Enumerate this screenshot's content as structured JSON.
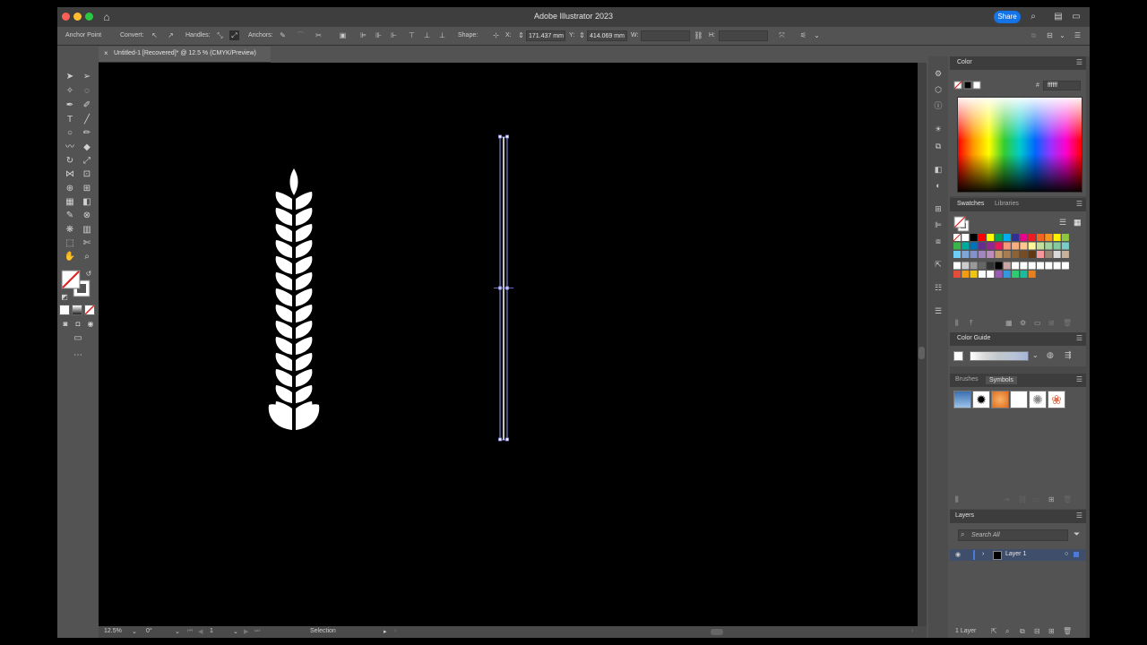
{
  "app": {
    "title": "Adobe Illustrator 2023",
    "share_label": "Share"
  },
  "control_bar": {
    "mode_label": "Anchor Point",
    "convert_label": "Convert:",
    "handles_label": "Handles:",
    "anchors_label": "Anchors:",
    "shape_label": "Shape:",
    "x_label": "X:",
    "x_value": "171.437 mm",
    "y_label": "Y:",
    "y_value": "414.069 mm",
    "w_label": "W:",
    "h_label": "H:"
  },
  "document": {
    "close_glyph": "×",
    "tab_label": "Untitled-1 [Recovered]* @ 12.5 % (CMYK/Preview)"
  },
  "status_bar": {
    "zoom": "12.5%",
    "rotation": "0°",
    "artboard": "1",
    "tool": "Selection"
  },
  "panels": {
    "color": {
      "title": "Color",
      "hex_value": "ffffff"
    },
    "swatches": {
      "tabs": [
        "Swatches",
        "Libraries"
      ]
    },
    "color_guide": {
      "title": "Color Guide"
    },
    "brushes_symbols": {
      "tabs": [
        "Brushes",
        "Symbols"
      ]
    },
    "layers": {
      "title": "Layers",
      "search_placeholder": "Search All",
      "layer_name": "Layer 1",
      "layer_count": "1 Layer"
    }
  },
  "colors": {
    "accent": "#1473e6",
    "selection": "#8d8ff0",
    "artwork": "#ffffff"
  }
}
